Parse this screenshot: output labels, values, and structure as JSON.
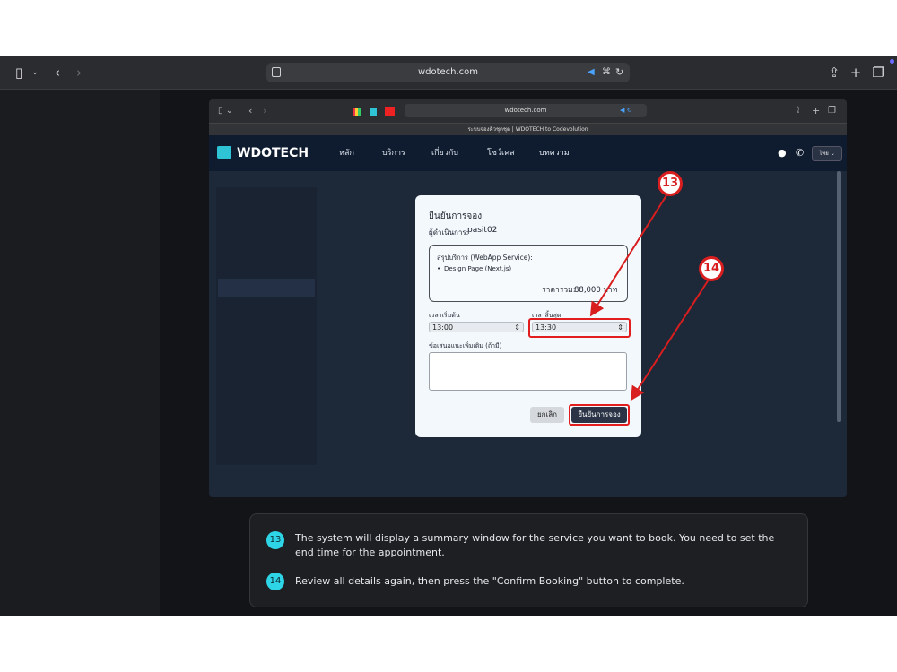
{
  "browser": {
    "url": "wdotech.com",
    "inner_url": "wdotech.com",
    "inner_tab_title": "ระบบจองคิวชุดชุด | WDOTECH to Codevolution"
  },
  "site": {
    "logo_text": "WDOTECH",
    "nav": [
      "หลัก",
      "บริการ",
      "เกี่ยวกับ",
      "โชว์เคส",
      "บทความ"
    ],
    "language": "ไทย"
  },
  "modal": {
    "title": "ยืนยันการจอง",
    "operator_label": "ผู้ดำเนินการ:",
    "operator_value": "pasit02",
    "summary_title": "สรุปบริการ (WebApp Service):",
    "summary_item": "Design Page (Next.js)",
    "total_label": "ราคารวม:",
    "total_value": "88,000 บาท",
    "start_label": "เวลาเริ่มต้น",
    "start_value": "13:00",
    "end_label": "เวลาสิ้นสุด",
    "end_value": "13:30",
    "note_label": "ข้อเสนอแนะเพิ่มเติม (ถ้ามี)",
    "cancel_label": "ยกเลิก",
    "confirm_label": "ยืนยันการจอง"
  },
  "annotations": {
    "badge_13": "13",
    "badge_14": "14",
    "accent_color": "#d81e1e"
  },
  "instructions": [
    {
      "num": "13",
      "text": "The system will display a summary window for the service you want to book. You need to set the end time for the appointment."
    },
    {
      "num": "14",
      "text": "Review all details again, then press the \"Confirm Booking\" button to complete."
    }
  ]
}
